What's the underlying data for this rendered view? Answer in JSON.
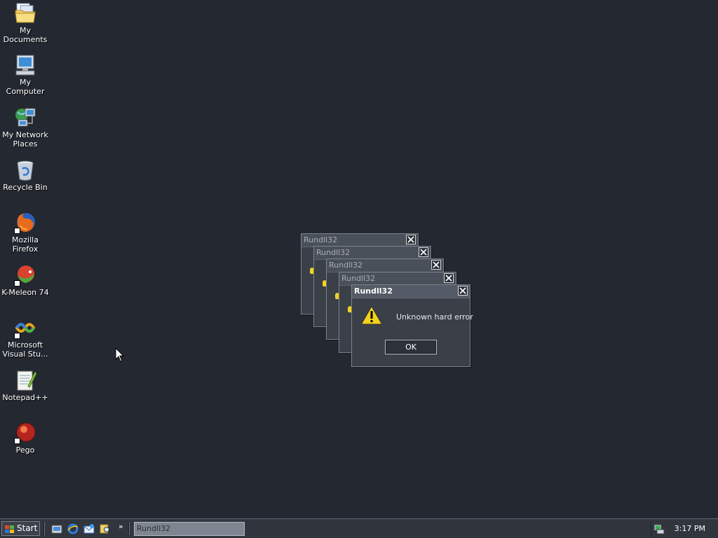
{
  "desktop": {
    "icons": [
      {
        "label": "My Documents",
        "icon": "my-documents-folder-icon"
      },
      {
        "label": "My Computer",
        "icon": "my-computer-icon"
      },
      {
        "label": "My Network Places",
        "icon": "network-places-icon"
      },
      {
        "label": "Recycle Bin",
        "icon": "recycle-bin-icon"
      },
      {
        "label": "Mozilla Firefox",
        "icon": "firefox-icon"
      },
      {
        "label": "K-Meleon 74",
        "icon": "k-meleon-icon"
      },
      {
        "label": "Microsoft Visual Stu...",
        "icon": "visual-studio-icon"
      },
      {
        "label": "Notepad++",
        "icon": "notepad-plus-plus-icon"
      },
      {
        "label": "Pego",
        "icon": "pego-icon"
      }
    ]
  },
  "dialogs": [
    {
      "title": "Rundll32",
      "active": false
    },
    {
      "title": "Rundll32",
      "active": false
    },
    {
      "title": "Rundll32",
      "active": false
    },
    {
      "title": "Rundll32",
      "active": false
    },
    {
      "title": "Rundll32",
      "active": true,
      "message": "Unknown hard error",
      "ok_label": "OK",
      "icon": "warning-icon"
    }
  ],
  "taskbar": {
    "start_label": "Start",
    "quick_launch": [
      "show-desktop-icon",
      "internet-explorer-icon",
      "outlook-express-icon",
      "search-icon"
    ],
    "more_glyph": "»",
    "task_button_label": "Rundll32",
    "clock": "3:17 PM",
    "tray_icon": "network-tray-icon"
  },
  "colors": {
    "desktop_bg": "#232831",
    "taskbar_bg": "#30353e",
    "warning_yellow": "#f2d21b"
  }
}
